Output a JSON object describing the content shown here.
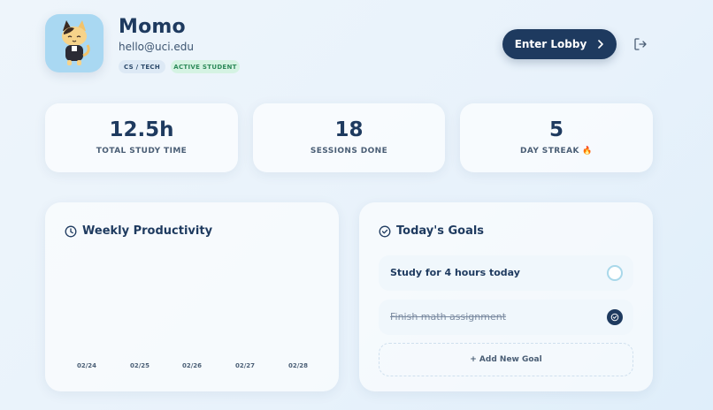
{
  "profile": {
    "name": "Momo",
    "email": "hello@uci.edu",
    "tags": [
      "CS / TECH",
      "ACTIVE STUDENT"
    ]
  },
  "header": {
    "lobby_button": "Enter Lobby"
  },
  "stats": [
    {
      "value": "12.5h",
      "label": "TOTAL STUDY TIME"
    },
    {
      "value": "18",
      "label": "SESSIONS DONE"
    },
    {
      "value": "5",
      "label": "DAY STREAK 🔥"
    }
  ],
  "weekly": {
    "title": "Weekly Productivity",
    "days": [
      "02/24",
      "02/25",
      "02/26",
      "02/27",
      "02/28"
    ]
  },
  "goals": {
    "title": "Today's Goals",
    "items": [
      {
        "text": "Study for 4 hours today",
        "done": false
      },
      {
        "text": "Finish math assignment",
        "done": true
      }
    ],
    "add_label": "+ Add New Goal"
  },
  "colors": {
    "primary": "#1e3a5f",
    "avatar_bg": "#a9d8f2",
    "status_tag_bg": "#d5f3e3",
    "status_tag_text": "#2e8a5a"
  },
  "icons": {
    "clock": "clock-icon",
    "check_circle": "check-circle-icon",
    "logout": "logout-icon",
    "chevron": "chevron-right-icon"
  }
}
